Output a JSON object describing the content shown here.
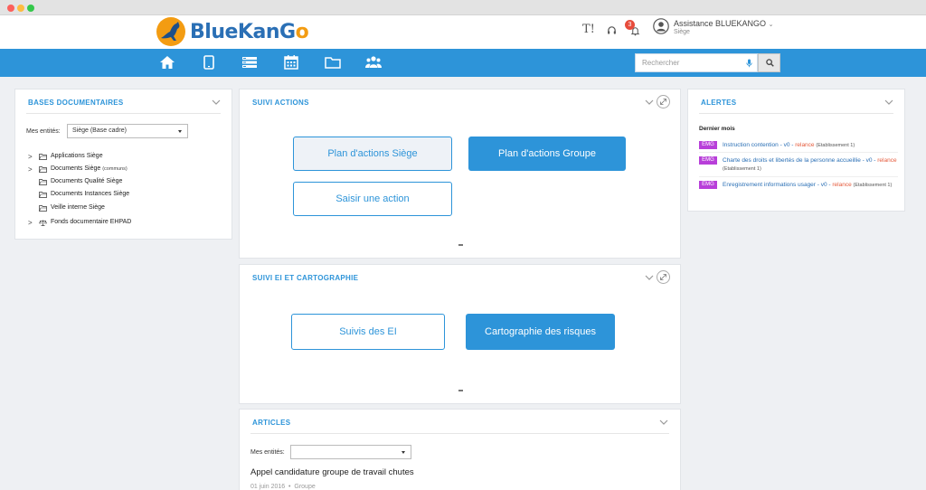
{
  "header": {
    "brand": "BlueKanGo",
    "text_size_icon": "T!",
    "notification_count": "3",
    "user_name": "Assistance BLUEKANGO",
    "user_site": "Siège"
  },
  "nav": {
    "icons": [
      "home-icon",
      "tablet-icon",
      "list-icon",
      "calendar-icon",
      "folder-icon",
      "group-icon"
    ],
    "search_placeholder": "Rechercher"
  },
  "bases": {
    "title": "BASES DOCUMENTAIRES",
    "entities_label": "Mes entités:",
    "entities_value": "Siège (Base cadre)",
    "tree": [
      {
        "label": "Applications Siège",
        "suffix": "",
        "arrow": ">"
      },
      {
        "label": "Documents Siège",
        "suffix": "(communs)",
        "arrow": ">"
      },
      {
        "label": "Documents Qualité Siège",
        "suffix": "",
        "arrow": ""
      },
      {
        "label": "Documents Instances Siège",
        "suffix": "",
        "arrow": ""
      },
      {
        "label": "Veille interne Siège",
        "suffix": "",
        "arrow": ""
      },
      {
        "label": "Fonds documentaire EHPAD",
        "suffix": "",
        "arrow": ">"
      }
    ]
  },
  "suivi_actions": {
    "title": "SUIVI ACTIONS",
    "btn_plan_siege": "Plan d'actions Siège",
    "btn_plan_groupe": "Plan d'actions Groupe",
    "btn_saisir": "Saisir une action"
  },
  "suivi_ei": {
    "title": "SUIVI EI ET CARTOGRAPHIE",
    "btn_suivis": "Suivis des EI",
    "btn_carto": "Cartographie des risques"
  },
  "articles": {
    "title": "ARTICLES",
    "entities_label": "Mes entités:",
    "entities_value": "",
    "item_title": "Appel candidature groupe de travail chutes",
    "item_date": "01 juin 2016",
    "item_sep": "•",
    "item_group": "Groupe"
  },
  "alertes": {
    "title": "ALERTES",
    "subtitle": "Dernier mois",
    "items": [
      {
        "tag": "EMG",
        "text": "Instruction contention - v0 -",
        "status": "relance",
        "etab": "(Etablissement 1)"
      },
      {
        "tag": "EMG",
        "text": "Charte des droits et libertés de la personne accueillie - v0 -",
        "status": "relance",
        "etab": "(Etablissement 1)"
      },
      {
        "tag": "EMG",
        "text": "Enregistrement informations usager - v0 -",
        "status": "relance",
        "etab": "(Etablissement 1)"
      }
    ]
  },
  "colors": {
    "accent": "#2d94d9",
    "emg": "#b83fd9",
    "relance": "#e55a3b"
  }
}
